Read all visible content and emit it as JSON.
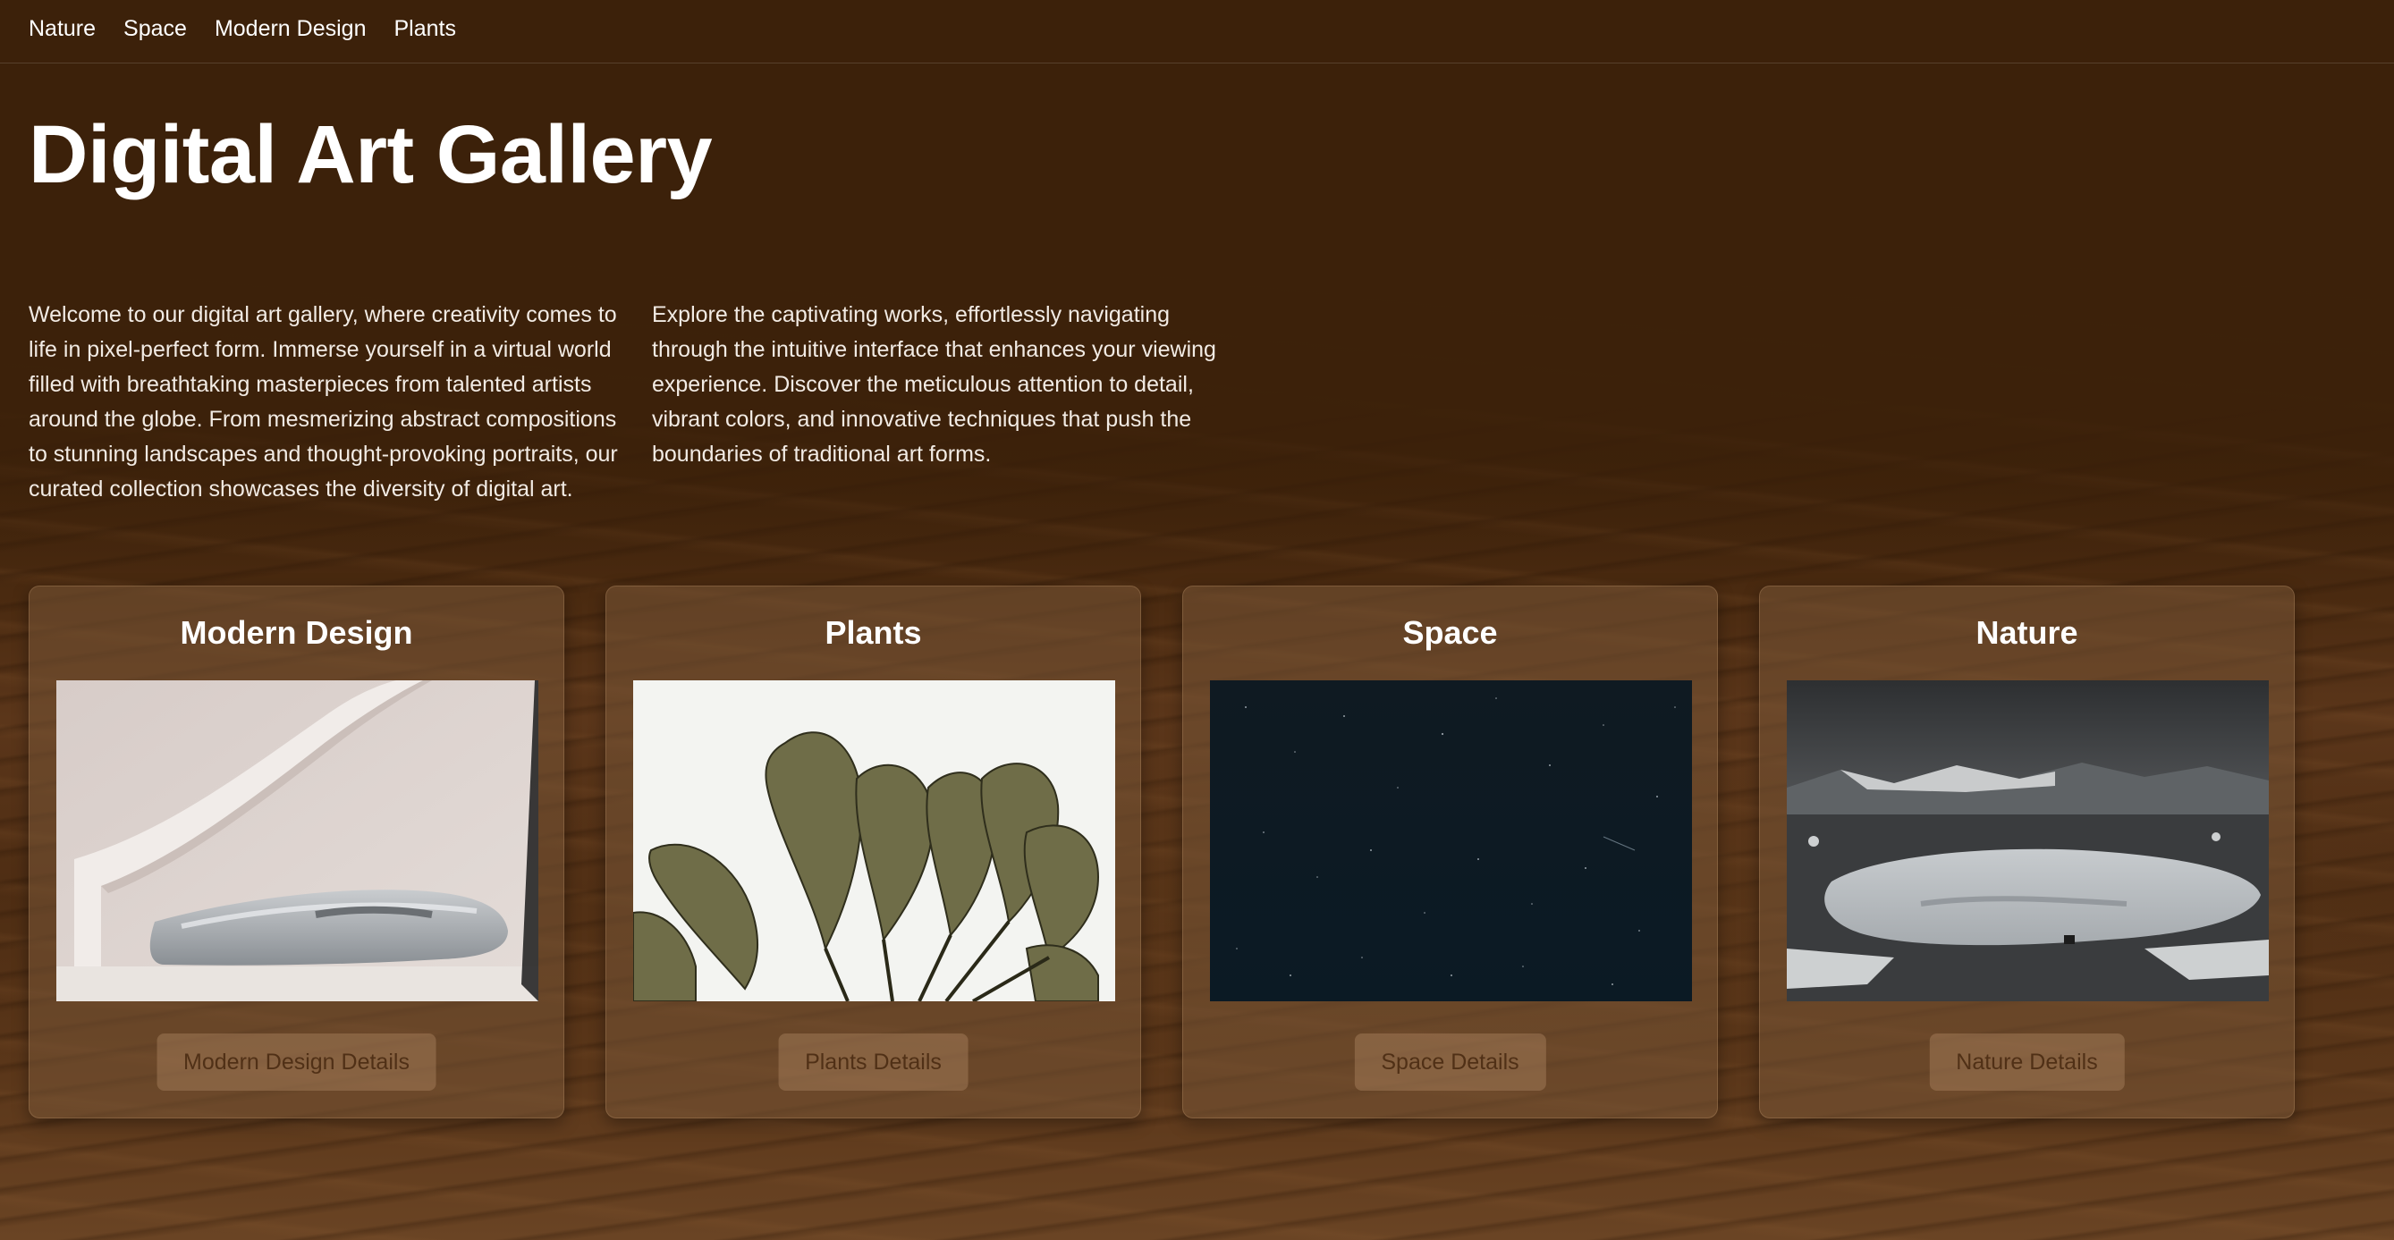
{
  "nav": {
    "items": [
      {
        "label": "Nature"
      },
      {
        "label": "Space"
      },
      {
        "label": "Modern Design"
      },
      {
        "label": "Plants"
      }
    ]
  },
  "hero": {
    "title": "Digital Art Gallery",
    "intro": "Welcome to our digital art gallery, where creativity comes to life in pixel-perfect form. Immerse yourself in a virtual world filled with breathtaking masterpieces from talented artists around the globe. From mesmerizing abstract compositions to stunning landscapes and thought-provoking portraits, our curated collection showcases the diversity of digital art. Explore the captivating works, effortlessly navigating through the intuitive interface that enhances your viewing experience. Discover the meticulous attention to detail, vibrant colors, and innovative techniques that push the boundaries of traditional art forms."
  },
  "cards": [
    {
      "title": "Modern Design",
      "button": "Modern Design Details",
      "image_icon": "modern-bench-image"
    },
    {
      "title": "Plants",
      "button": "Plants Details",
      "image_icon": "banana-leaves-image"
    },
    {
      "title": "Space",
      "button": "Space Details",
      "image_icon": "starfield-image"
    },
    {
      "title": "Nature",
      "button": "Nature Details",
      "image_icon": "mountain-lake-image"
    }
  ],
  "colors": {
    "background": "#3c210a",
    "card": "#785537",
    "text": "#ffffff"
  }
}
